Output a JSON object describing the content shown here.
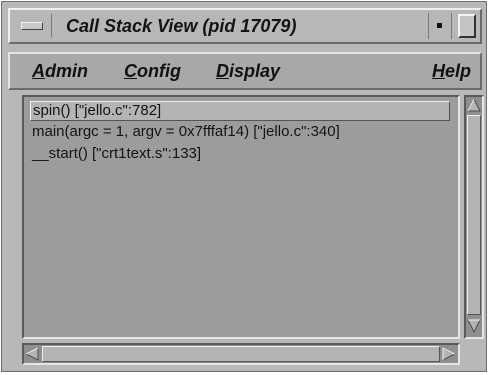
{
  "window": {
    "title": "Call Stack View (pid 17079)"
  },
  "menubar": {
    "items": [
      {
        "label": "Admin",
        "mnemonic": "A",
        "rest": "dmin"
      },
      {
        "label": "Config",
        "mnemonic": "C",
        "rest": "onfig"
      },
      {
        "label": "Display",
        "mnemonic": "D",
        "rest": "isplay"
      },
      {
        "label": "Help",
        "mnemonic": "H",
        "rest": "elp"
      }
    ]
  },
  "call_stack": {
    "frames": [
      {
        "text": "spin() [\"jello.c\":782]",
        "selected": true
      },
      {
        "text": "main(argc = 1, argv = 0x7fffaf14) [\"jello.c\":340]",
        "selected": false
      },
      {
        "text": "__start() [\"crt1text.s\":133]",
        "selected": false
      }
    ]
  },
  "icons": {
    "window_menu": "window-menu-icon",
    "minimize": "minimize-icon",
    "maximize": "maximize-icon",
    "scroll_up": "arrow-up-icon",
    "scroll_down": "arrow-down-icon",
    "scroll_left": "arrow-left-icon",
    "scroll_right": "arrow-right-icon"
  }
}
